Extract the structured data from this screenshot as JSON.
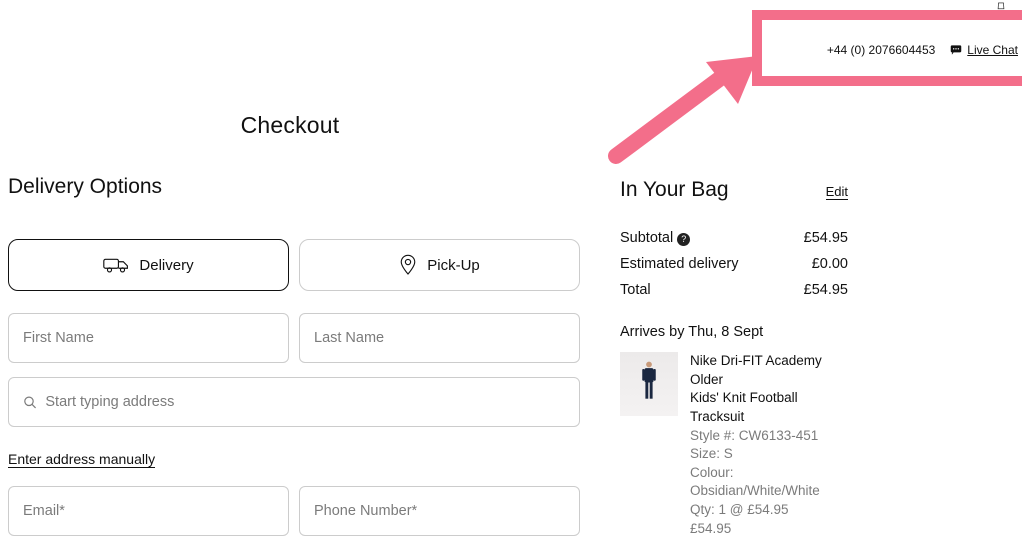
{
  "header": {
    "phone": "+44 (0) 2076604453",
    "live_chat_label": "Live Chat"
  },
  "page_title": "Checkout",
  "delivery": {
    "section_title": "Delivery Options",
    "method_delivery": "Delivery",
    "method_pickup": "Pick-Up",
    "first_name_ph": "First Name",
    "last_name_ph": "Last Name",
    "address_ph": "Start typing address",
    "manual_link": "Enter address manually",
    "email_ph": "Email*",
    "phone_ph": "Phone Number*"
  },
  "bag": {
    "title": "In Your Bag",
    "edit": "Edit",
    "subtotal_label": "Subtotal",
    "subtotal_value": "£54.95",
    "delivery_label": "Estimated delivery",
    "delivery_value": "£0.00",
    "total_label": "Total",
    "total_value": "£54.95",
    "arrives": "Arrives by Thu, 8 Sept",
    "product": {
      "name_line1": "Nike Dri-FIT Academy Older",
      "name_line2": "Kids' Knit Football Tracksuit",
      "style": "Style #: CW6133-451",
      "size": "Size: S",
      "colour": "Colour: Obsidian/White/White",
      "qty": "Qty: 1 @ £54.95",
      "price": "£54.95"
    }
  }
}
